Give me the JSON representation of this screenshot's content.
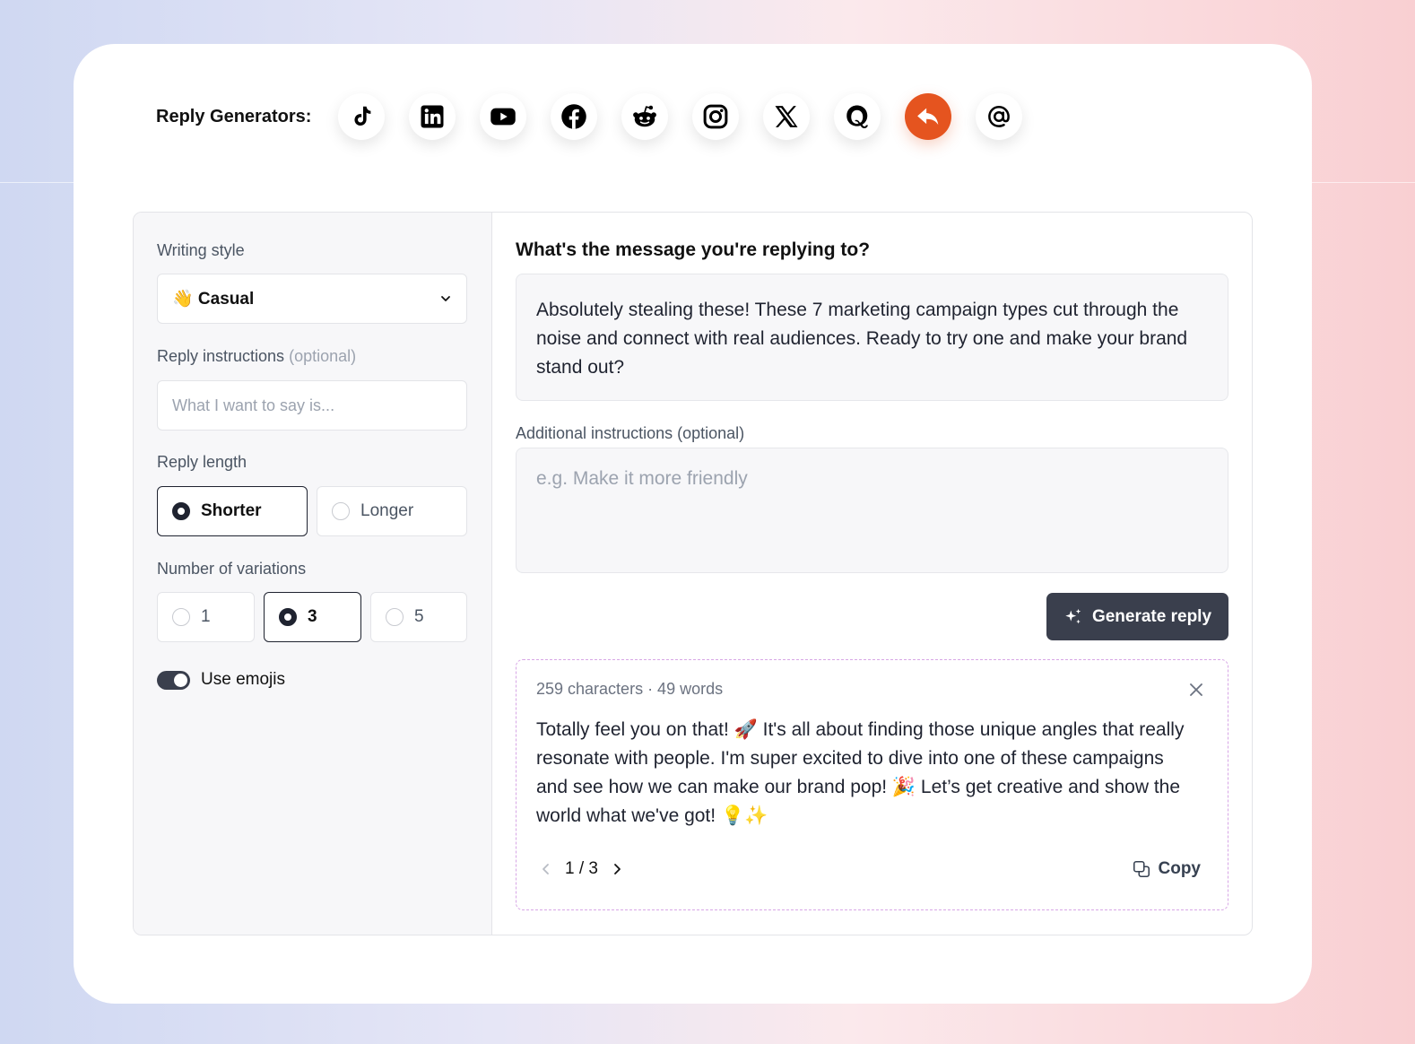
{
  "header": {
    "label": "Reply Generators:",
    "generators": [
      {
        "name": "tiktok-icon"
      },
      {
        "name": "linkedin-icon"
      },
      {
        "name": "youtube-icon"
      },
      {
        "name": "facebook-icon"
      },
      {
        "name": "reddit-icon"
      },
      {
        "name": "instagram-icon"
      },
      {
        "name": "x-icon"
      },
      {
        "name": "quora-icon"
      },
      {
        "name": "reply-icon",
        "active": true
      },
      {
        "name": "email-icon"
      }
    ],
    "active_color": "#e5541f"
  },
  "settings": {
    "writing_style_label": "Writing style",
    "writing_style_value": "👋 Casual",
    "reply_instructions_label": "Reply instructions",
    "reply_instructions_optional": "(optional)",
    "reply_instructions_placeholder": "What I want to say is...",
    "reply_length_label": "Reply length",
    "length_options": [
      "Shorter",
      "Longer"
    ],
    "length_selected": "Shorter",
    "variations_label": "Number of variations",
    "variation_options": [
      "1",
      "3",
      "5"
    ],
    "variation_selected": "3",
    "use_emojis_label": "Use emojis",
    "use_emojis_on": true
  },
  "main": {
    "question": "What's the message you're replying to?",
    "message": "Absolutely stealing these! These 7 marketing campaign types cut through the noise and connect with real audiences. Ready to try one and make your brand stand out?",
    "additional_label": "Additional instructions (optional)",
    "additional_placeholder": "e.g. Make it more friendly",
    "generate_label": "Generate reply",
    "button_color": "#3a3f4d"
  },
  "result": {
    "stats": "259 characters · 49 words",
    "text": "Totally feel you on that! 🚀 It's all about finding those unique angles that really resonate with people. I'm super excited to dive into one of these campaigns and see how we can make our brand pop! 🎉 Let’s get creative and show the world what we've got! 💡✨",
    "pager": "1 / 3",
    "copy_label": "Copy"
  }
}
